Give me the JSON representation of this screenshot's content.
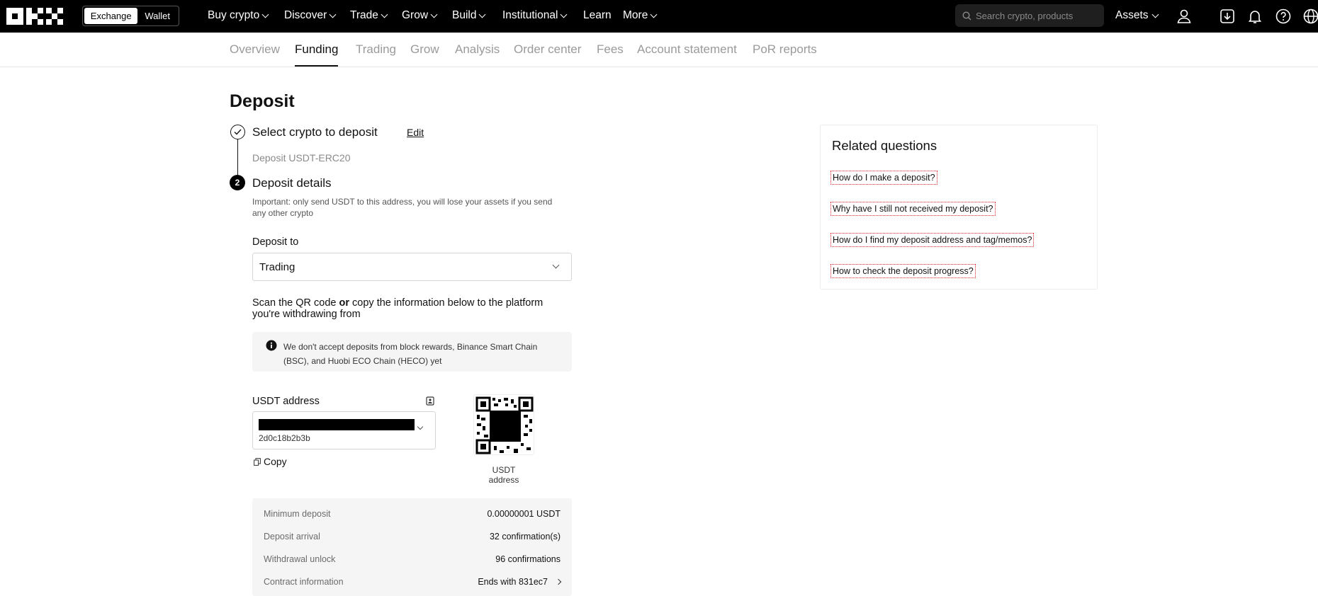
{
  "topbar": {
    "logo_name": "OKX",
    "mode_exchange": "Exchange",
    "mode_wallet": "Wallet",
    "nav": [
      {
        "label": "Buy crypto",
        "has_menu": true
      },
      {
        "label": "Discover",
        "has_menu": true
      },
      {
        "label": "Trade",
        "has_menu": true
      },
      {
        "label": "Grow",
        "has_menu": true
      },
      {
        "label": "Build",
        "has_menu": true
      },
      {
        "label": "Institutional",
        "has_menu": true
      },
      {
        "label": "Learn",
        "has_menu": false
      },
      {
        "label": "More",
        "has_menu": true
      }
    ],
    "search_placeholder": "Search crypto, products",
    "assets_label": "Assets",
    "icons": [
      "user-icon",
      "download-icon",
      "bell-icon",
      "help-icon",
      "globe-icon"
    ]
  },
  "subnav": {
    "tabs": [
      "Overview",
      "Funding",
      "Trading",
      "Grow",
      "Analysis",
      "Order center",
      "Fees",
      "Account statement",
      "PoR reports"
    ],
    "active": "Funding"
  },
  "deposit": {
    "title": "Deposit",
    "step1_title": "Select crypto to deposit",
    "edit_label": "Edit",
    "step1_value": "Deposit USDT-ERC20",
    "step2_number": "2",
    "step2_title": "Deposit details",
    "important_line1": "Important: only send USDT to this address, you will lose your assets if you send",
    "important_line2": "any other crypto",
    "deposit_to_label": "Deposit to",
    "deposit_to_value": "Trading",
    "scan_part1": "Scan the QR code ",
    "scan_or": "or",
    "scan_part2": " copy the information below to the platform",
    "scan_line2": "you're withdrawing from",
    "notice_line1": "We don't accept deposits from block rewards, Binance Smart Chain",
    "notice_line2": "(BSC), and Huobi ECO Chain (HECO) yet",
    "address_label": "USDT address",
    "address_tail": "2d0c18b2b3b",
    "copy_label": "Copy",
    "qr_caption": "USDT address",
    "info_rows": [
      {
        "label": "Minimum deposit",
        "value": "0.00000001 USDT"
      },
      {
        "label": "Deposit arrival",
        "value": "32 confirmation(s)"
      },
      {
        "label": "Withdrawal unlock",
        "value": "96 confirmations"
      },
      {
        "label": "Contract information",
        "value": "Ends with 831ec7"
      }
    ]
  },
  "related": {
    "title": "Related questions",
    "questions": [
      "How do I make a deposit?",
      "Why have I still not received my deposit?",
      "How do I find my deposit address and tag/memos?",
      "How to check the deposit progress?"
    ]
  }
}
